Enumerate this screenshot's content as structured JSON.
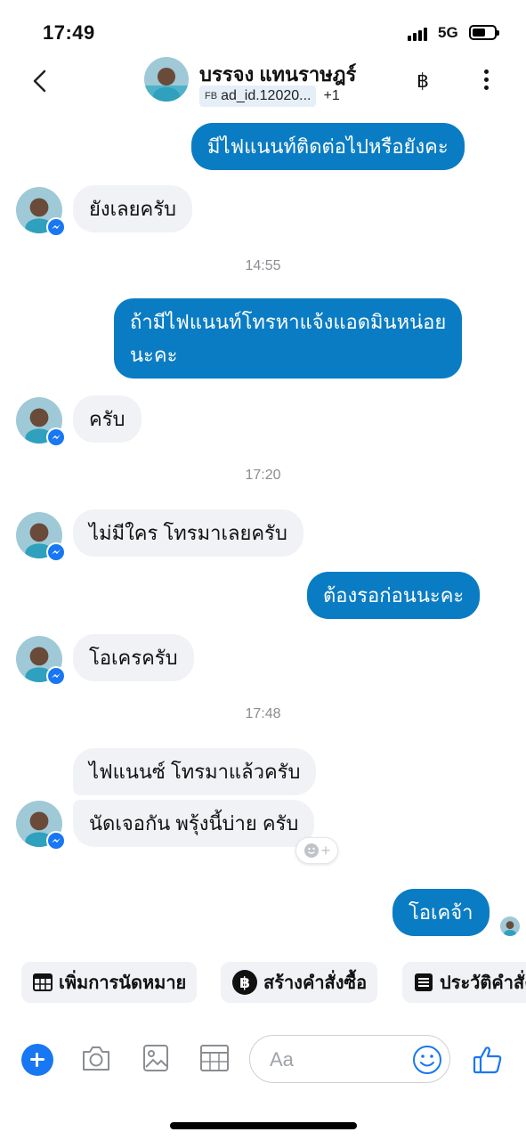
{
  "status_bar": {
    "time": "17:49",
    "network": "5G"
  },
  "header": {
    "contact_name": "บรรจง แทนราษฎร์",
    "ad_prefix": "FB",
    "ad_label": "ad_id.12020...",
    "ad_more": "+1",
    "currency_symbol": "฿"
  },
  "messages": [
    {
      "dir": "out",
      "text": "มีไฟแนนท์ติดต่อไปหรือยังคะ"
    },
    {
      "dir": "in",
      "text": "ยังเลยครับ"
    },
    {
      "type": "timestamp",
      "text": "14:55"
    },
    {
      "dir": "out",
      "lines": [
        "ถ้ามีไฟแนนท์โทรหาแจ้งแอดมินหน่อย",
        "นะคะ"
      ]
    },
    {
      "dir": "in",
      "text": "ครับ"
    },
    {
      "type": "timestamp",
      "text": "17:20"
    },
    {
      "dir": "in",
      "text": "ไม่มีใคร โทรมาเลยครับ"
    },
    {
      "dir": "out",
      "text": "ต้องรอก่อนนะคะ"
    },
    {
      "dir": "in",
      "text": "โอเครครับ"
    },
    {
      "type": "timestamp",
      "text": "17:48"
    },
    {
      "dir": "in",
      "text": "ไฟแนนซ์ โทรมาแล้วครับ"
    },
    {
      "dir": "in",
      "text": "นัดเจอกัน พรุ้งนี้บ่าย ครับ"
    },
    {
      "dir": "out",
      "text": "โอเคจ้า"
    }
  ],
  "quick_replies": [
    {
      "label": "เพิ่มการนัดหมาย",
      "icon": "calendar-icon"
    },
    {
      "label": "สร้างคำสั่งซื้อ",
      "icon": "baht-icon"
    },
    {
      "label": "ประวัติคำสั่ง",
      "icon": "list-icon"
    }
  ],
  "composer": {
    "placeholder": "Aa"
  },
  "colors": {
    "outgoing_bubble": "#0a7cc4",
    "incoming_bubble": "#f1f2f5",
    "accent": "#1877f2"
  }
}
